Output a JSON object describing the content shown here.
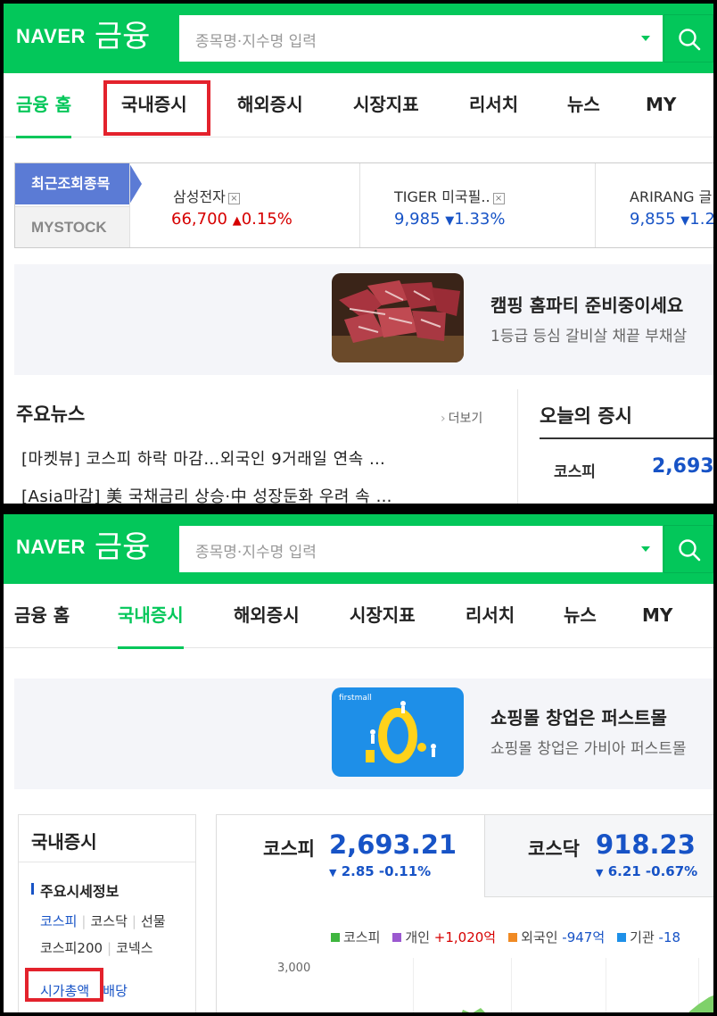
{
  "brand": {
    "naver": "NAVER",
    "finance": "금융"
  },
  "search": {
    "placeholder": "종목명·지수명 입력"
  },
  "nav": [
    "금융 홈",
    "국내증시",
    "해외증시",
    "시장지표",
    "리서치",
    "뉴스",
    "MY"
  ],
  "panel1": {
    "active_tab": "금융 홈",
    "recent": {
      "tag_recent": "최근조회종목",
      "tag_mystock": "MYSTOCK",
      "items": [
        {
          "name": "삼성전자",
          "price": "66,700",
          "change": "0.15%",
          "direction": "up"
        },
        {
          "name": "TIGER 미국필..",
          "price": "9,985",
          "change": "1.33%",
          "direction": "down"
        },
        {
          "name": "ARIRANG 글",
          "price": "9,855",
          "change": "1.2",
          "direction": "down"
        }
      ]
    },
    "ad": {
      "title": "캠핑 홈파티 준비중이세요",
      "desc": "1등급 등심 갈비살 채끝 부채살"
    },
    "news": {
      "title": "주요뉴스",
      "more": "더보기",
      "items": [
        "[마켓뷰] 코스피 하락 마감…외국인 9거래일 연속 …",
        "[Asia마감] 美 국채금리 상승·中 성장둔화 우려 속 …"
      ]
    },
    "today": {
      "title": "오늘의 증시",
      "kospi_label": "코스피",
      "kospi_value": "2,693."
    }
  },
  "panel2": {
    "active_tab": "국내증시",
    "ad": {
      "brand": "firstmall",
      "title": "쇼핑몰 창업은 퍼스트몰",
      "desc": "쇼핑몰 창업은 가비아 퍼스트몰"
    },
    "sidebar": {
      "title": "국내증시",
      "section": "주요시세정보",
      "links_row1": [
        "코스피",
        "코스닥",
        "선물"
      ],
      "links_row2": [
        "코스피200",
        "코넥스"
      ],
      "links_row3": [
        "시가총액",
        "배당"
      ]
    },
    "market": {
      "kospi": {
        "label": "코스피",
        "value": "2,693.21",
        "change": "2.85 -0.11%"
      },
      "kosdaq": {
        "label": "코스닥",
        "value": "918.23",
        "change": "6.21 -0.67%"
      },
      "legend": {
        "kospi": "코스피",
        "individual_label": "개인",
        "individual_value": "+1,020억",
        "foreign_label": "외국인",
        "foreign_value": "-947억",
        "inst_label": "기관",
        "inst_value": "-18"
      },
      "y_tick": "3,000"
    }
  },
  "colors": {
    "brand_green": "#03c75a",
    "up_red": "#d60000",
    "down_blue": "#1753c6",
    "highlight_red": "#e3222c"
  }
}
